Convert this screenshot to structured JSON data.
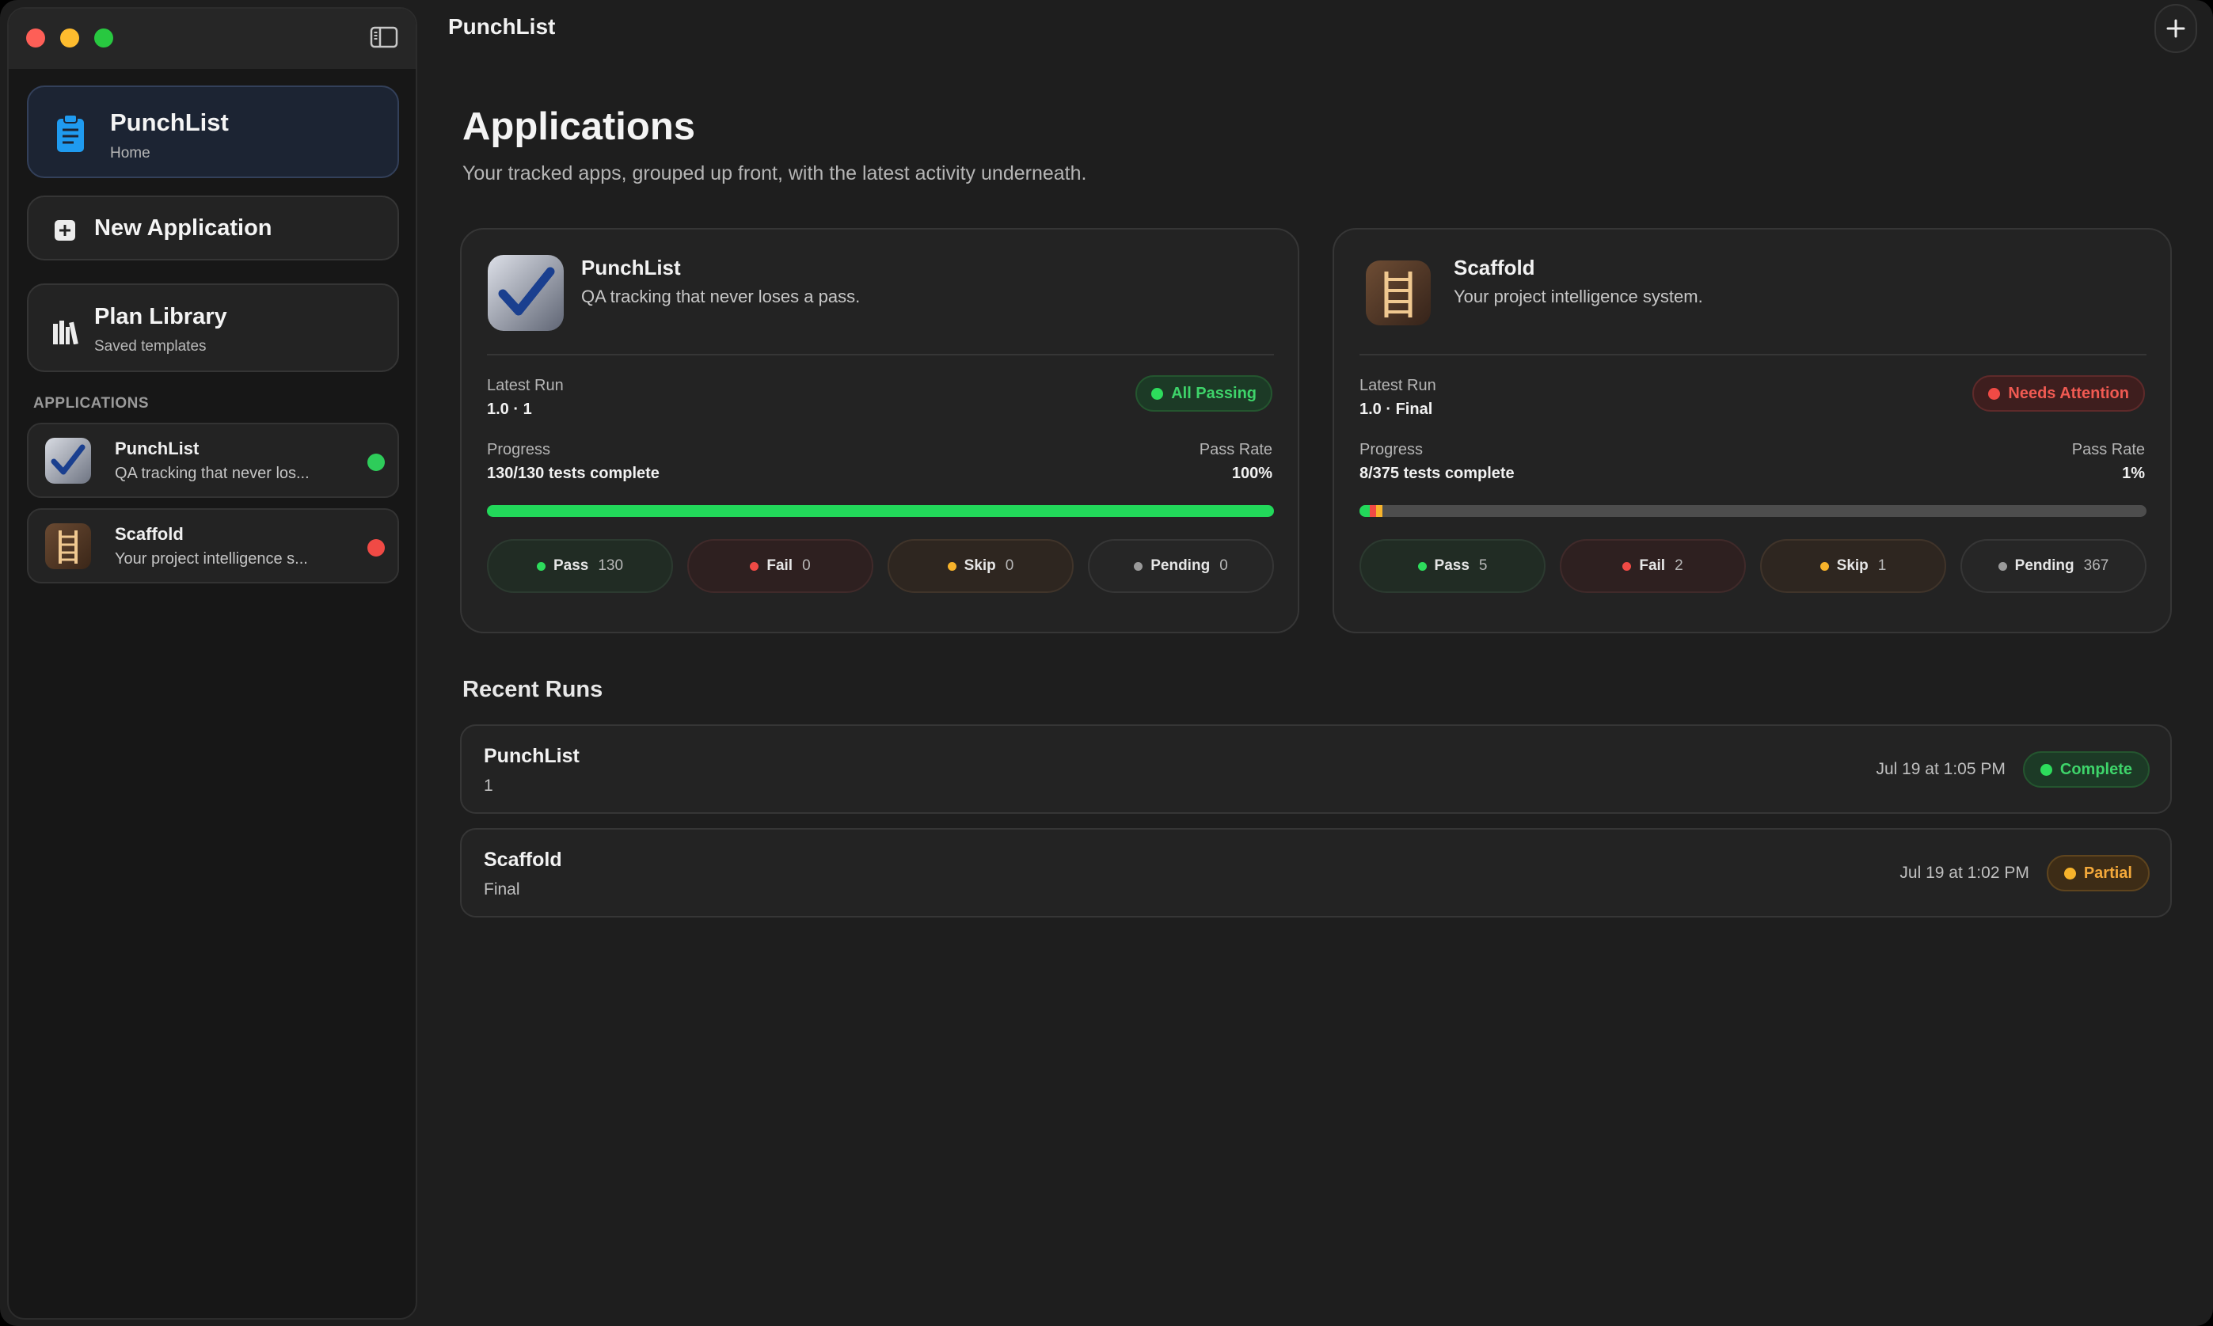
{
  "window": {
    "title": "PunchList"
  },
  "sidebar": {
    "home": {
      "title": "PunchList",
      "subtitle": "Home"
    },
    "new_application": {
      "title": "New Application"
    },
    "plan_library": {
      "title": "Plan Library",
      "subtitle": "Saved templates"
    },
    "section_label": "APPLICATIONS",
    "apps": [
      {
        "name": "PunchList",
        "desc": "QA tracking that never los...",
        "status_color": "#2ecc5a"
      },
      {
        "name": "Scaffold",
        "desc": "Your project intelligence s...",
        "status_color": "#f04a45"
      }
    ]
  },
  "main": {
    "title": "Applications",
    "subtitle": "Your tracked apps, grouped up front, with the latest activity underneath.",
    "cards": [
      {
        "name": "PunchList",
        "desc": "QA tracking that never loses a pass.",
        "icon": "checkmark-app-icon",
        "latest_run_label": "Latest Run",
        "latest_run_value": "1.0 · 1",
        "status": "All Passing",
        "progress_label": "Progress",
        "progress_value": "130/130 tests complete",
        "pass_rate_label": "Pass Rate",
        "pass_rate_value": "100%",
        "progress": {
          "pass": 130,
          "fail": 0,
          "skip": 0,
          "pending": 0,
          "total": 130
        },
        "chips": [
          {
            "label": "Pass",
            "count": "130"
          },
          {
            "label": "Fail",
            "count": "0"
          },
          {
            "label": "Skip",
            "count": "0"
          },
          {
            "label": "Pending",
            "count": "0"
          }
        ]
      },
      {
        "name": "Scaffold",
        "desc": "Your project intelligence system.",
        "icon": "ladder-app-icon",
        "latest_run_label": "Latest Run",
        "latest_run_value": "1.0 · Final",
        "status": "Needs Attention",
        "progress_label": "Progress",
        "progress_value": "8/375 tests complete",
        "pass_rate_label": "Pass Rate",
        "pass_rate_value": "1%",
        "progress": {
          "pass": 5,
          "fail": 2,
          "skip": 1,
          "pending": 367,
          "total": 375
        },
        "chips": [
          {
            "label": "Pass",
            "count": "5"
          },
          {
            "label": "Fail",
            "count": "2"
          },
          {
            "label": "Skip",
            "count": "1"
          },
          {
            "label": "Pending",
            "count": "367"
          }
        ]
      }
    ],
    "recent_runs_title": "Recent Runs",
    "recent_runs": [
      {
        "name": "PunchList",
        "sub": "1",
        "time": "Jul 19 at 1:05 PM",
        "status": "Complete"
      },
      {
        "name": "Scaffold",
        "sub": "Final",
        "time": "Jul 19 at 1:02 PM",
        "status": "Partial"
      }
    ]
  }
}
